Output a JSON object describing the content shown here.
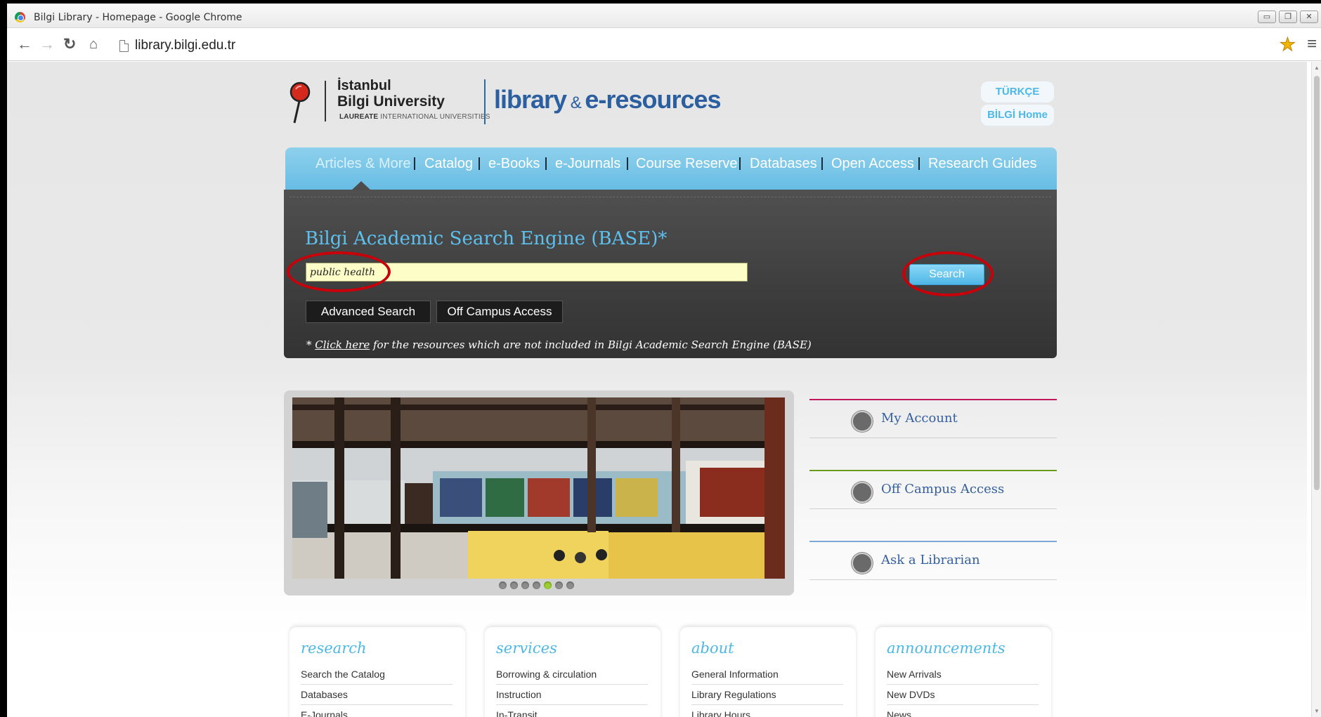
{
  "browser": {
    "window_title": "Bilgi Library - Homepage - Google Chrome",
    "url": "library.bilgi.edu.tr",
    "window_buttons": [
      "minimize-icon",
      "restore-icon",
      "close-icon"
    ]
  },
  "header": {
    "logo_line1": "İstanbul",
    "logo_line2": "Bilgi University",
    "logo_line3_bold": "LAUREATE",
    "logo_line3_rest": " INTERNATIONAL UNIVERSITIES",
    "library_title_1": "library",
    "library_title_amp": " & ",
    "library_title_2": "e-resources",
    "lang_link": "TÜRKÇE",
    "home_link": "BİLGİ Home"
  },
  "search_tabs": [
    "Articles & More",
    "Catalog",
    "e-Books",
    "e-Journals",
    "Course Reserve",
    "Databases",
    "Open Access",
    "Research Guides"
  ],
  "search": {
    "title": "Bilgi Academic Search Engine (BASE)*",
    "query": "public health",
    "button": "Search",
    "advanced_button": "Advanced Search",
    "offcampus_button": "Off Campus Access",
    "note_prefix": "* ",
    "note_link": "Click here",
    "note_rest": " for the resources which are not included in Bilgi Academic Search Engine (BASE)"
  },
  "slideshow": {
    "dot_count": 7,
    "active_index": 4
  },
  "quick_links": [
    {
      "label": "My Account",
      "icon": "user-icon",
      "color": "#c2185b"
    },
    {
      "label": "Off Campus Access",
      "icon": "globe-icon",
      "color": "#6a9a1f"
    },
    {
      "label": "Ask a Librarian",
      "icon": "chat-icon",
      "color": "#7aa9d6"
    }
  ],
  "footer": {
    "research": {
      "title": "research",
      "items": [
        "Search the Catalog",
        "Databases",
        "E-Journals"
      ]
    },
    "services": {
      "title": "services",
      "items": [
        "Borrowing & circulation",
        "Instruction",
        "In-Transit"
      ]
    },
    "about": {
      "title": "about",
      "items": [
        "General Information",
        "Library Regulations",
        "Library Hours"
      ]
    },
    "announcements": {
      "title": "announcements",
      "items": [
        "New Arrivals",
        "New DVDs",
        "News"
      ]
    }
  },
  "colors": {
    "accent_blue": "#4cb8e6",
    "title_blue": "#2b5fa0",
    "highlight_red": "#c8000a",
    "input_yellow": "#fdfdc8"
  }
}
